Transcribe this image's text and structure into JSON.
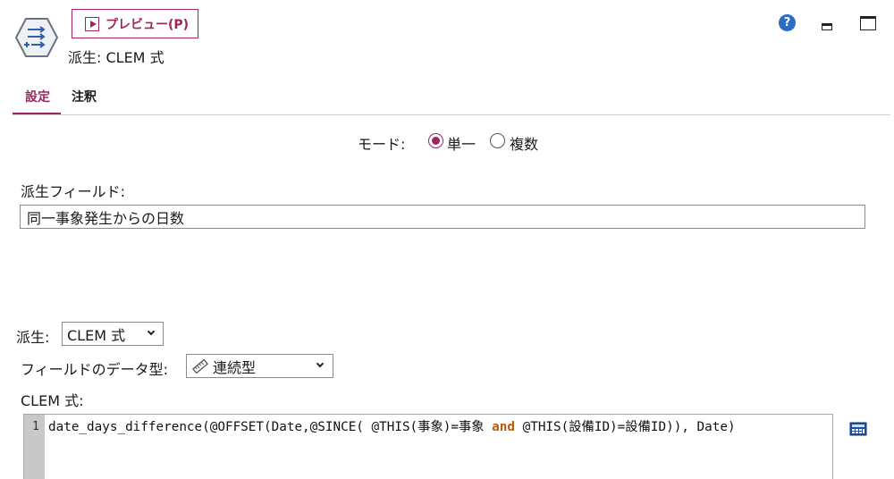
{
  "header": {
    "node_title": "派生: CLEM 式",
    "preview_label": "プレビュー(P)",
    "node_icon": "derive-node-icon",
    "help_icon_glyph": "?",
    "accent_color": "#a0245e"
  },
  "tabs": [
    {
      "label": "設定",
      "active": true
    },
    {
      "label": "注釈",
      "active": false
    }
  ],
  "mode": {
    "label": "モード:",
    "options": [
      {
        "label": "単一",
        "selected": true
      },
      {
        "label": "複数",
        "selected": false
      }
    ]
  },
  "derive_field": {
    "label": "派生フィールド:",
    "value": "同一事象発生からの日数"
  },
  "derive_as": {
    "label": "派生:",
    "value": "CLEM 式"
  },
  "field_type": {
    "label": "フィールドのデータ型:",
    "value": "連続型",
    "icon": "ruler-icon"
  },
  "clem": {
    "label": "CLEM 式:",
    "line_number": "1",
    "code_before": "date_days_difference(@OFFSET(Date,@SINCE( @THIS(事象)=事象 ",
    "keyword": "and",
    "code_after": " @THIS(設備ID)=設備ID)), Date)"
  }
}
